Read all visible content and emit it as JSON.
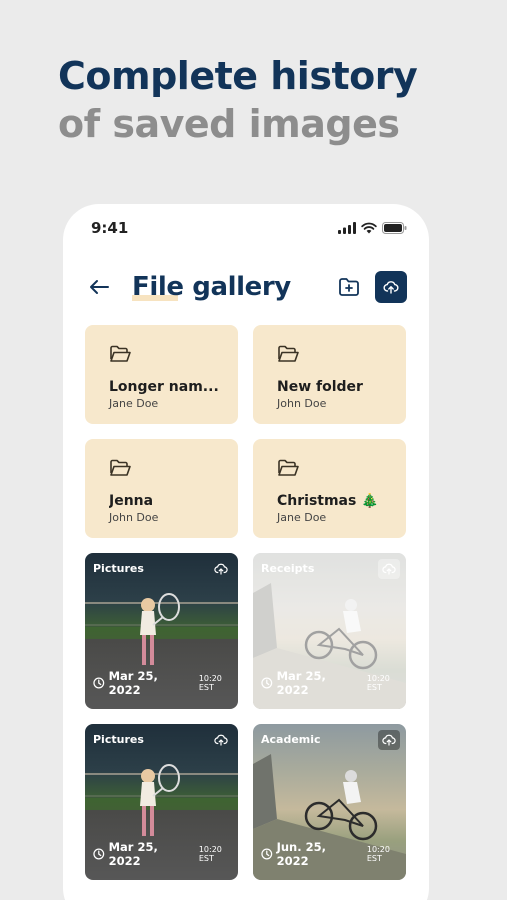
{
  "headline": {
    "line1": "Complete history",
    "line2": "of saved images"
  },
  "status_bar": {
    "time": "9:41"
  },
  "app_bar": {
    "title": "File gallery"
  },
  "folders": [
    {
      "name": "Longer nam...",
      "owner": "Jane Doe"
    },
    {
      "name": "New folder",
      "owner": "John Doe"
    },
    {
      "name": "Jenna",
      "owner": "John Doe"
    },
    {
      "name": "Christmas 🎄",
      "owner": "Jane Doe"
    }
  ],
  "photos": [
    {
      "tag": "Pictures",
      "date": "Mar 25, 2022",
      "time": "10:20 EST",
      "subject": "child-with-racket"
    },
    {
      "tag": "Receipts",
      "date": "Mar 25, 2022",
      "time": "10:20 EST",
      "subject": "child-on-bike"
    },
    {
      "tag": "Pictures",
      "date": "Mar 25, 2022",
      "time": "10:20 EST",
      "subject": "child-with-racket"
    },
    {
      "tag": "Academic",
      "date": "Jun. 25, 2022",
      "time": "10:20 EST",
      "subject": "child-on-bike"
    }
  ],
  "colors": {
    "brand_navy": "#123459",
    "headline_gray": "#8d8d8d",
    "folder_bg": "#f7e8cc",
    "page_bg": "#ebebeb"
  }
}
